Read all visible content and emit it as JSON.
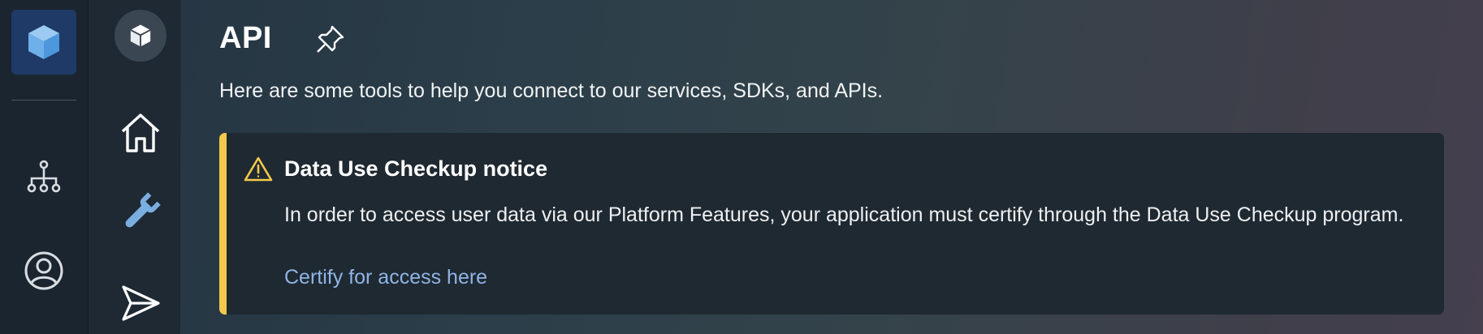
{
  "page": {
    "title": "API",
    "subtitle": "Here are some tools to help you connect to our services, SDKs, and APIs."
  },
  "notice": {
    "title": "Data Use Checkup notice",
    "body": "In order to access user data via our Platform Features, your application must certify through the Data Use Checkup program.",
    "link": "Certify for access here",
    "accent_color": "#f2c94c",
    "link_color": "#8fb4e6"
  },
  "rail": {
    "icons": [
      "app-cube-icon",
      "hierarchy-icon",
      "user-circle-icon"
    ]
  },
  "subnav": {
    "icons": [
      "app-cube-icon",
      "home-icon",
      "wrench-icon",
      "send-icon"
    ]
  },
  "colors": {
    "app_tile": "#1f3a66",
    "rail_bg": "#1b252f",
    "subnav_bg": "#1e2933"
  }
}
